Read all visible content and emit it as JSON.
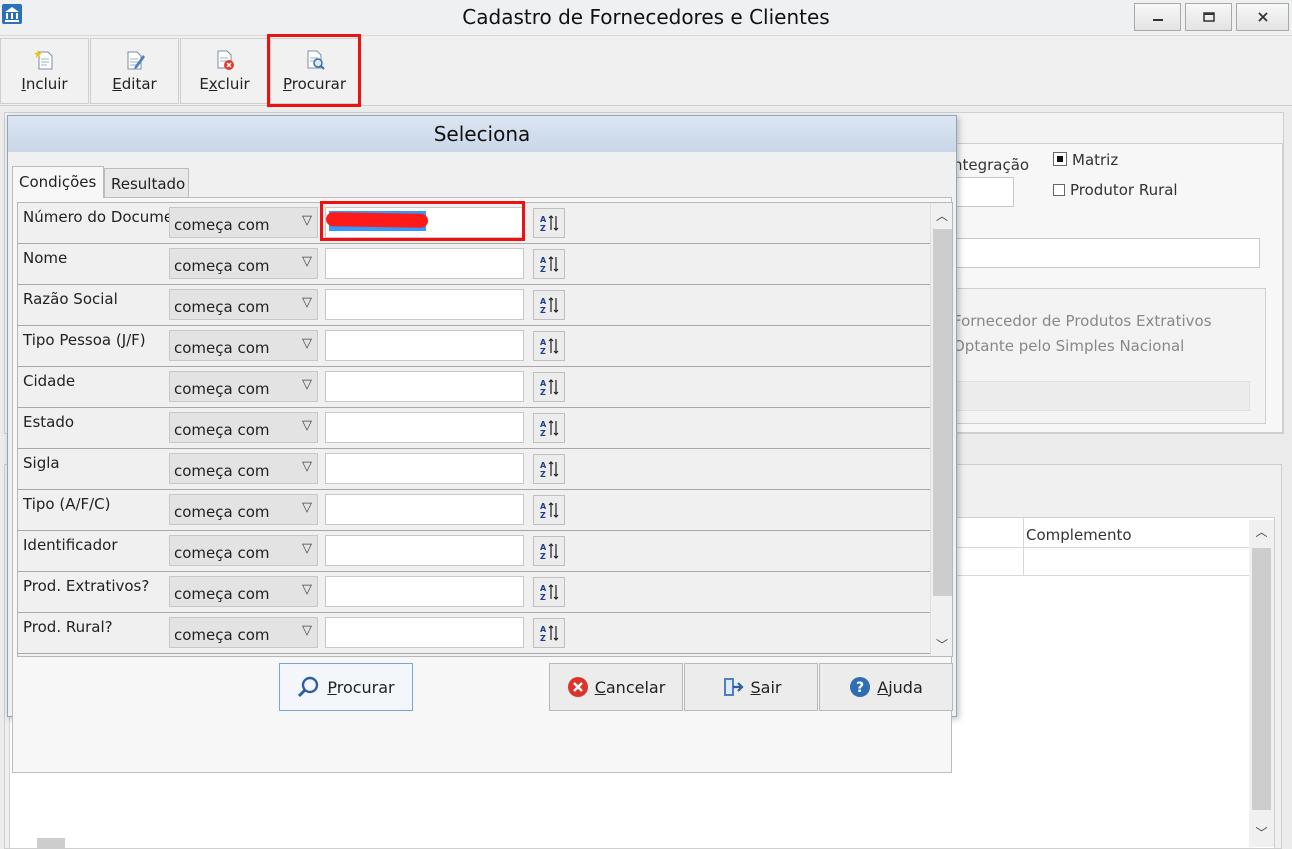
{
  "window": {
    "title": "Cadastro de Fornecedores e Clientes",
    "controls": [
      "minimize",
      "maximize",
      "close"
    ]
  },
  "toolbar": {
    "buttons": [
      {
        "key": "I",
        "rest": "ncluir",
        "icon": "new-document-icon"
      },
      {
        "key": "E",
        "rest": "ditar",
        "icon": "edit-document-icon"
      },
      {
        "pre": "E",
        "key": "x",
        "rest": "cluir",
        "icon": "delete-document-icon"
      },
      {
        "key": "P",
        "rest": "rocurar",
        "icon": "search-document-icon"
      }
    ]
  },
  "background_form": {
    "integracao_label": "ntegração",
    "matriz_label": "Matriz",
    "matriz_checked": true,
    "produtor_rural_label": "Produtor Rural",
    "produtor_rural_checked": false,
    "fornecedor_extrativos_label": "Fornecedor de Produtos Extrativos",
    "optante_simples_label": "Optante pelo Simples Nacional",
    "grid_column": "Complemento"
  },
  "dialog": {
    "title": "Seleciona",
    "tabs": [
      "Condições",
      "Resultado"
    ],
    "active_tab": "Condições",
    "conditions": [
      {
        "field": "Número do Documento",
        "operator": "começa com",
        "value": ""
      },
      {
        "field": "Nome",
        "operator": "começa com",
        "value": ""
      },
      {
        "field": "Razão Social",
        "operator": "começa com",
        "value": ""
      },
      {
        "field": "Tipo Pessoa (J/F)",
        "operator": "começa com",
        "value": ""
      },
      {
        "field": "Cidade",
        "operator": "começa com",
        "value": ""
      },
      {
        "field": "Estado",
        "operator": "começa com",
        "value": ""
      },
      {
        "field": "Sigla",
        "operator": "começa com",
        "value": ""
      },
      {
        "field": "Tipo (A/F/C)",
        "operator": "começa com",
        "value": ""
      },
      {
        "field": "Identificador",
        "operator": "começa com",
        "value": ""
      },
      {
        "field": "Prod. Extrativos?",
        "operator": "começa com",
        "value": ""
      },
      {
        "field": "Prod. Rural?",
        "operator": "começa com",
        "value": ""
      }
    ],
    "buttons": {
      "procurar": {
        "key": "P",
        "rest": "rocurar"
      },
      "cancelar": {
        "key": "C",
        "rest": "ancelar"
      },
      "sair": {
        "key": "S",
        "rest": "air"
      },
      "ajuda": {
        "key": "A",
        "rest": "juda"
      }
    }
  },
  "colors": {
    "highlight": "#ee1111",
    "redaction": "#ff1a1a",
    "selection": "#3399ff"
  }
}
